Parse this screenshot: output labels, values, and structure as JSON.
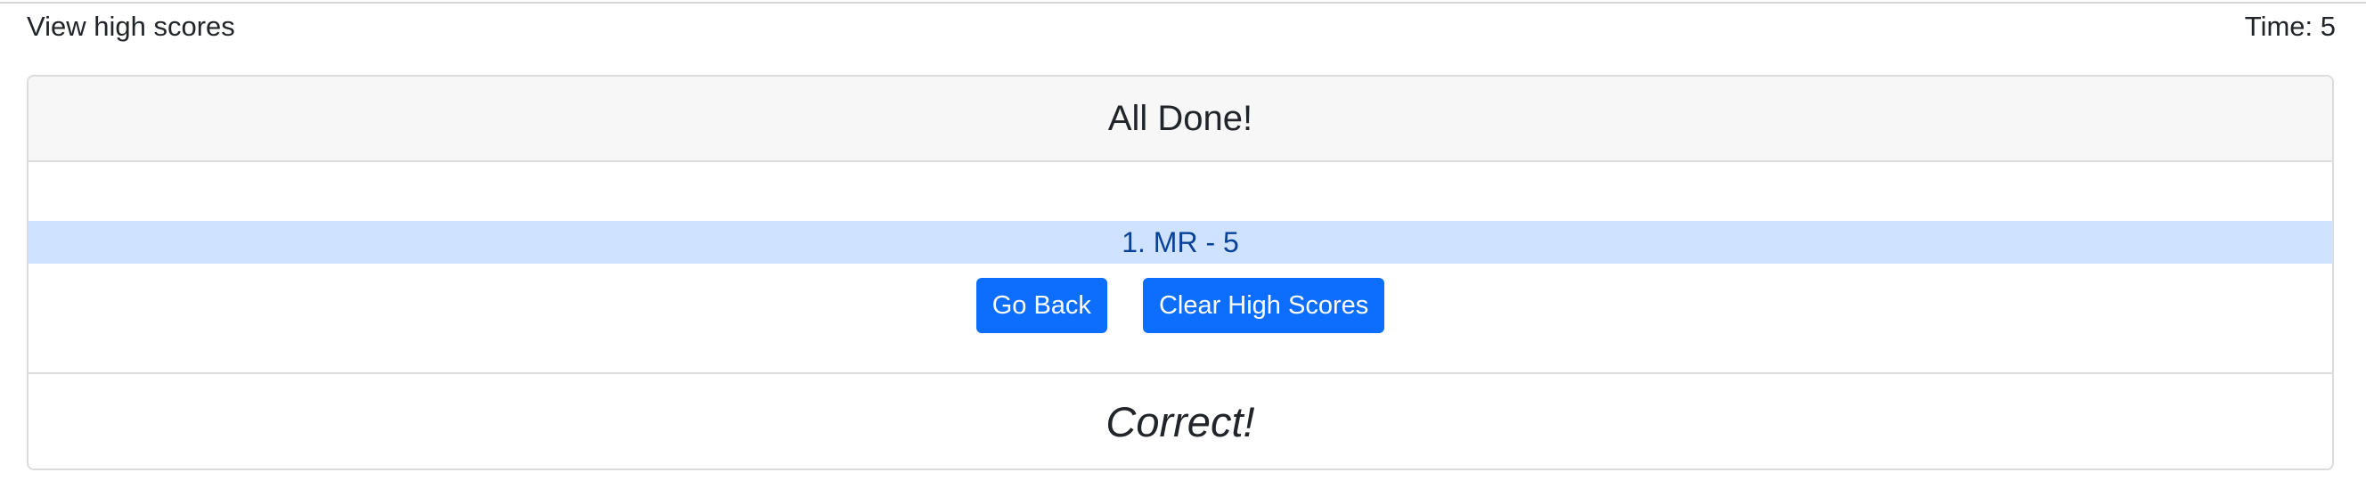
{
  "topbar": {
    "high_scores_link": "View high scores",
    "timer_text": "Time: 5"
  },
  "card": {
    "title": "All Done!",
    "scores": [
      {
        "text": "1. MR - 5"
      }
    ],
    "buttons": {
      "go_back": "Go Back",
      "clear": "Clear High Scores"
    },
    "feedback": "Correct!"
  },
  "colors": {
    "primary": "#0d6efd",
    "list_highlight_bg": "#cfe2ff",
    "list_highlight_text": "#084298",
    "header_bg": "#f7f7f7"
  }
}
